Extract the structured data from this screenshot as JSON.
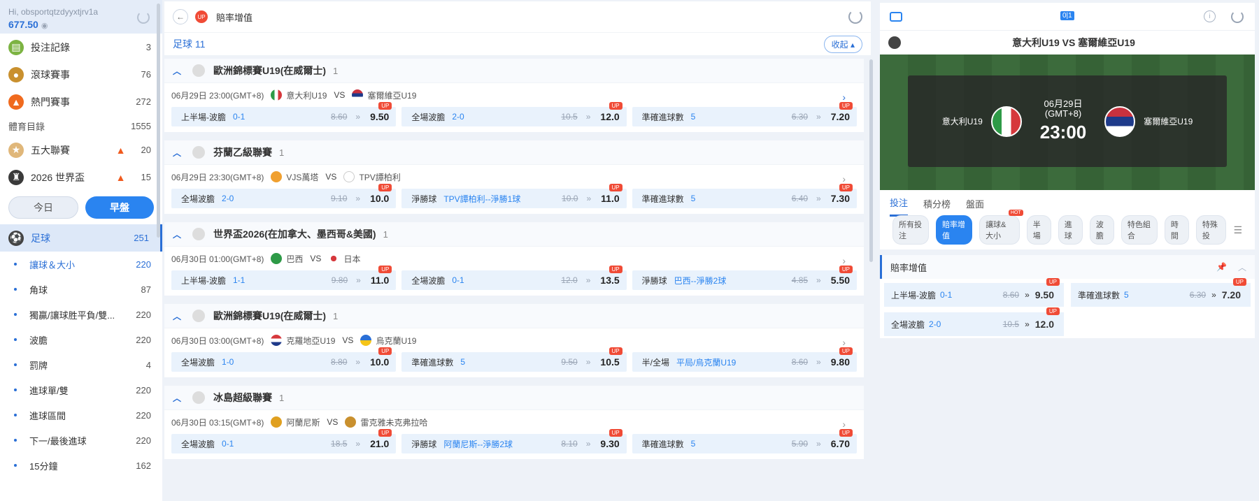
{
  "user": {
    "greeting": "Hi, obsportqtzdyyxtjrv1a",
    "balance": "677.50"
  },
  "sidebar": {
    "top": [
      {
        "label": "投注記錄",
        "count": "3"
      },
      {
        "label": "滾球賽事",
        "count": "76"
      },
      {
        "label": "熱門賽事",
        "count": "272"
      }
    ],
    "catalog": {
      "label": "體育目錄",
      "count": "1555"
    },
    "featured": [
      {
        "label": "五大聯賽",
        "count": "20"
      },
      {
        "label": "2026 世界盃",
        "count": "15"
      }
    ],
    "toggle": {
      "today": "今日",
      "early": "早盤"
    },
    "sport": {
      "label": "足球",
      "count": "251"
    },
    "subs": [
      {
        "label": "讓球＆大小",
        "count": "220"
      },
      {
        "label": "角球",
        "count": "87"
      },
      {
        "label": "獨贏/讓球胜平負/雙...",
        "count": "220"
      },
      {
        "label": "波膽",
        "count": "220"
      },
      {
        "label": "罰牌",
        "count": "4"
      },
      {
        "label": "進球單/雙",
        "count": "220"
      },
      {
        "label": "進球區間",
        "count": "220"
      },
      {
        "label": "下一/最後進球",
        "count": "220"
      },
      {
        "label": "15分鐘",
        "count": "162"
      }
    ]
  },
  "main": {
    "title": "賠率增值",
    "section": "足球 11",
    "collapse": "收起",
    "leagues": [
      {
        "name": "歐洲錦標賽U19(在威爾士)",
        "count": "1",
        "time": "06月29日 23:00(GMT+8)",
        "home": "意大利U19",
        "vs": "VS",
        "away": "塞爾維亞U19",
        "odds": [
          {
            "k": "上半場-波膽",
            "s": "0-1",
            "o": "8.60",
            "n": "9.50"
          },
          {
            "k": "全場波膽",
            "s": "2-0",
            "o": "10.5",
            "n": "12.0"
          },
          {
            "k": "準確進球數",
            "s": "5",
            "o": "6.30",
            "n": "7.20"
          }
        ]
      },
      {
        "name": "芬蘭乙級聯賽",
        "count": "1",
        "time": "06月29日 23:30(GMT+8)",
        "home": "VJS萬塔",
        "vs": "VS",
        "away": "TPV譚柏利",
        "odds": [
          {
            "k": "全場波膽",
            "s": "2-0",
            "o": "9.10",
            "n": "10.0"
          },
          {
            "k": "淨勝球",
            "s": "TPV譚柏利--淨勝1球",
            "o": "10.0",
            "n": "11.0"
          },
          {
            "k": "準確進球數",
            "s": "5",
            "o": "6.40",
            "n": "7.30"
          }
        ]
      },
      {
        "name": "世界盃2026(在加拿大、墨西哥&美國)",
        "count": "1",
        "time": "06月30日 01:00(GMT+8)",
        "home": "巴西",
        "vs": "VS",
        "away": "日本",
        "odds": [
          {
            "k": "上半場-波膽",
            "s": "1-1",
            "o": "9.80",
            "n": "11.0"
          },
          {
            "k": "全場波膽",
            "s": "0-1",
            "o": "12.0",
            "n": "13.5"
          },
          {
            "k": "淨勝球",
            "s": "巴西--淨勝2球",
            "o": "4.85",
            "n": "5.50"
          }
        ]
      },
      {
        "name": "歐洲錦標賽U19(在威爾士)",
        "count": "1",
        "time": "06月30日 03:00(GMT+8)",
        "home": "克羅地亞U19",
        "vs": "VS",
        "away": "烏克蘭U19",
        "odds": [
          {
            "k": "全場波膽",
            "s": "1-0",
            "o": "8.80",
            "n": "10.0"
          },
          {
            "k": "準確進球數",
            "s": "5",
            "o": "9.50",
            "n": "10.5"
          },
          {
            "k": "半/全場",
            "s": "平局/烏克蘭U19",
            "o": "8.60",
            "n": "9.80"
          }
        ]
      },
      {
        "name": "冰島超級聯賽",
        "count": "1",
        "time": "06月30日 03:15(GMT+8)",
        "home": "阿蘭尼斯",
        "vs": "VS",
        "away": "雷克雅未克弗拉哈",
        "odds": [
          {
            "k": "全場波膽",
            "s": "0-1",
            "o": "18.5",
            "n": "21.0"
          },
          {
            "k": "淨勝球",
            "s": "阿蘭尼斯--淨勝2球",
            "o": "8.10",
            "n": "9.30"
          },
          {
            "k": "準確進球數",
            "s": "5",
            "o": "5.90",
            "n": "6.70"
          }
        ]
      }
    ]
  },
  "right": {
    "score_icon": "0|1",
    "match": "意大利U19  VS  塞爾維亞U19",
    "home": "意大利U19",
    "away": "塞爾維亞U19",
    "date": "06月29日",
    "tz": "(GMT+8)",
    "time": "23:00",
    "tabs": [
      "投注",
      "積分榜",
      "盤面"
    ],
    "chips": [
      "所有投注",
      "賠率增值",
      "讓球&大小",
      "半場",
      "進球",
      "波膽",
      "特色組合",
      "時間",
      "特殊投"
    ],
    "hot": "HOT",
    "panel_title": "賠率增值",
    "panel": [
      {
        "k": "上半場-波膽",
        "s": "0-1",
        "o": "8.60",
        "n": "9.50"
      },
      {
        "k": "準確進球數",
        "s": "5",
        "o": "6.30",
        "n": "7.20"
      },
      {
        "k": "全場波膽",
        "s": "2-0",
        "o": "10.5",
        "n": "12.0"
      }
    ]
  },
  "badge": "UP",
  "colors": {
    "accent": "#2a84f0",
    "up": "#f04b36"
  }
}
